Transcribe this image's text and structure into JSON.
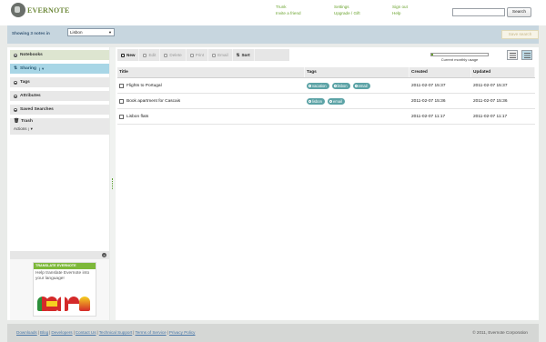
{
  "header": {
    "logo_text": "EVERNOTE",
    "links_col1": [
      "Trunk",
      "Invite a friend"
    ],
    "links_col2": [
      "Settings",
      "Upgrade / Gift"
    ],
    "links_col3": [
      "Sign out",
      "Help"
    ],
    "search_value": "",
    "search_button": "Search"
  },
  "filter": {
    "showing_text": "Showing 3 notes in",
    "notebook": "Lisbon",
    "save_search": "Save search"
  },
  "sidebar": {
    "items": [
      {
        "label": "Notebooks"
      },
      {
        "label": "Sharing"
      },
      {
        "label": "Tags"
      },
      {
        "label": "Attributes"
      },
      {
        "label": "Saved Searches"
      }
    ],
    "trash": "Trash",
    "actions": "Actions"
  },
  "translate": {
    "header": "TRANSLATE EVERNOTE",
    "body": "Help translate Evernote into your language!"
  },
  "toolbar": {
    "new": "New",
    "edit": "Edit",
    "delete": "Delete",
    "print": "Print",
    "email": "Email",
    "sort": "Sort"
  },
  "usage": {
    "label": "Current monthly usage",
    "fraction": 0.03
  },
  "table": {
    "headers": [
      "Title",
      "Tags",
      "Created",
      "Updated"
    ],
    "rows": [
      {
        "title": "Flights to Portugal",
        "tags": [
          "vacation",
          "lisbon",
          "email"
        ],
        "created": "2011-02-07 15:37",
        "updated": "2011-02-07 15:37"
      },
      {
        "title": "Book apartment for Cascais",
        "tags": [
          "lisbon",
          "email"
        ],
        "created": "2011-02-07 15:36",
        "updated": "2011-02-07 15:36"
      },
      {
        "title": "Lisbon flats",
        "tags": [],
        "created": "2011-02-07 11:17",
        "updated": "2011-02-07 11:17"
      }
    ]
  },
  "footer": {
    "links": [
      "Downloads",
      "Blog",
      "Developers",
      "Contact Us",
      "Technical Support",
      "Terms of Service",
      "Privacy Policy"
    ],
    "copyright": "© 2011, Evernote Corporation"
  },
  "colors": {
    "accent_green": "#6aa32e",
    "tag_teal": "#5ca3a6",
    "filter_bar": "#c7d6df"
  }
}
